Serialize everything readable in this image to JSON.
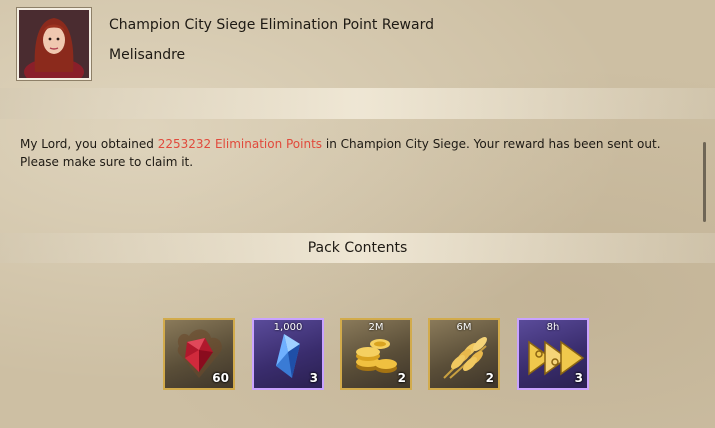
{
  "mail": {
    "title": "Champion City Siege Elimination Point Reward",
    "sender": "Melisandre",
    "message_prefix": "My Lord, you obtained ",
    "message_highlight": "2253232 Elimination Points",
    "message_suffix": " in Champion City Siege. Your reward has been sent out. Please make sure to claim it."
  },
  "pack": {
    "title": "Pack Contents",
    "items": [
      {
        "icon": "ruby-gem-icon",
        "top_label": "",
        "count": "60"
      },
      {
        "icon": "blue-crystal-icon",
        "top_label": "1,000",
        "count": "3"
      },
      {
        "icon": "gold-coins-icon",
        "top_label": "2M",
        "count": "2"
      },
      {
        "icon": "wheat-icon",
        "top_label": "6M",
        "count": "2"
      },
      {
        "icon": "speedup-arrows-icon",
        "top_label": "8h",
        "count": "3"
      }
    ]
  },
  "colors": {
    "highlight": "#e14a3c",
    "item_border_gold": "#d2ab4c",
    "item_border_purple": "#c9a3ff"
  }
}
